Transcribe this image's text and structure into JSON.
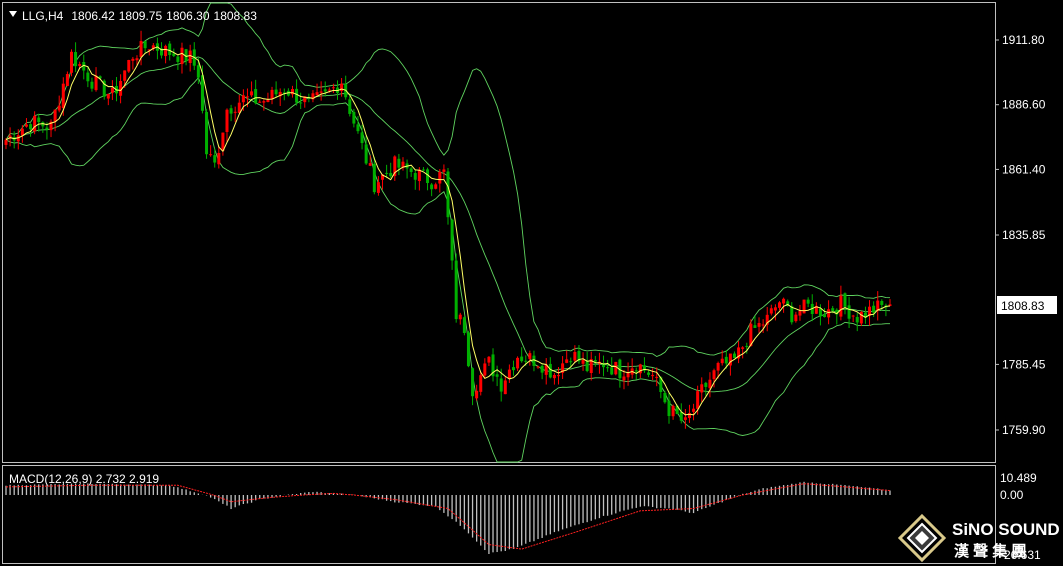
{
  "header": {
    "symbol": "LLG,H4",
    "open": "1806.42",
    "high": "1809.75",
    "low": "1806.30",
    "close": "1808.83"
  },
  "price_axis": {
    "ticks": [
      "1911.80",
      "1886.60",
      "1861.40",
      "1835.85",
      "1785.45",
      "1759.90"
    ],
    "current": "1808.83",
    "current_value": 1808.83,
    "tick_values": [
      1911.8,
      1886.6,
      1861.4,
      1835.85,
      1785.45,
      1759.9
    ],
    "range": [
      1744,
      1922
    ]
  },
  "macd": {
    "label": "MACD(12,26,9) 2.732 2.919",
    "ticks": [
      "10.489",
      "0.00",
      "-26.631"
    ],
    "tick_values": [
      10.489,
      0.0,
      -26.631
    ],
    "range": [
      -27.5,
      12.5
    ]
  },
  "logo": {
    "name": "SiNO SOUND",
    "subtitle": "漢 聲 集 團"
  },
  "colors": {
    "background": "#000000",
    "bull_candle": "#ff0000",
    "bear_candle": "#00b000",
    "bollinger": "#5fd35f",
    "moving_average": "#ffff66",
    "macd_histogram": "#c0c0c0",
    "macd_signal": "#ff2020",
    "frame": "#c0c0c0"
  },
  "chart_data": [
    {
      "type": "candlestick",
      "title": "LLG,H4",
      "ylim": [
        1744,
        1922
      ],
      "keypoints_close": [
        {
          "bar": 0,
          "close": 1873
        },
        {
          "bar": 6,
          "close": 1880
        },
        {
          "bar": 11,
          "close": 1878
        },
        {
          "bar": 16,
          "close": 1906
        },
        {
          "bar": 21,
          "close": 1896
        },
        {
          "bar": 26,
          "close": 1890
        },
        {
          "bar": 31,
          "close": 1906
        },
        {
          "bar": 35,
          "close": 1910
        },
        {
          "bar": 40,
          "close": 1907
        },
        {
          "bar": 45,
          "close": 1905
        },
        {
          "bar": 47,
          "close": 1899
        },
        {
          "bar": 49,
          "close": 1868
        },
        {
          "bar": 51,
          "close": 1863
        },
        {
          "bar": 54,
          "close": 1885
        },
        {
          "bar": 58,
          "close": 1889
        },
        {
          "bar": 63,
          "close": 1888
        },
        {
          "bar": 68,
          "close": 1893
        },
        {
          "bar": 74,
          "close": 1887
        },
        {
          "bar": 78,
          "close": 1890
        },
        {
          "bar": 82,
          "close": 1896
        },
        {
          "bar": 84,
          "close": 1885
        },
        {
          "bar": 87,
          "close": 1870
        },
        {
          "bar": 90,
          "close": 1856
        },
        {
          "bar": 95,
          "close": 1863
        },
        {
          "bar": 100,
          "close": 1860
        },
        {
          "bar": 104,
          "close": 1857
        },
        {
          "bar": 107,
          "close": 1860
        },
        {
          "bar": 110,
          "close": 1805
        },
        {
          "bar": 112,
          "close": 1800
        },
        {
          "bar": 114,
          "close": 1776
        },
        {
          "bar": 118,
          "close": 1786
        },
        {
          "bar": 121,
          "close": 1778
        },
        {
          "bar": 125,
          "close": 1789
        },
        {
          "bar": 130,
          "close": 1787
        },
        {
          "bar": 134,
          "close": 1782
        },
        {
          "bar": 138,
          "close": 1790
        },
        {
          "bar": 142,
          "close": 1784
        },
        {
          "bar": 146,
          "close": 1786
        },
        {
          "bar": 150,
          "close": 1783
        },
        {
          "bar": 154,
          "close": 1786
        },
        {
          "bar": 158,
          "close": 1781
        },
        {
          "bar": 162,
          "close": 1768
        },
        {
          "bar": 166,
          "close": 1762
        },
        {
          "bar": 170,
          "close": 1775
        },
        {
          "bar": 174,
          "close": 1784
        },
        {
          "bar": 178,
          "close": 1787
        },
        {
          "bar": 182,
          "close": 1798
        },
        {
          "bar": 186,
          "close": 1803
        },
        {
          "bar": 189,
          "close": 1810
        },
        {
          "bar": 192,
          "close": 1805
        },
        {
          "bar": 196,
          "close": 1808
        },
        {
          "bar": 200,
          "close": 1806
        },
        {
          "bar": 204,
          "close": 1809
        },
        {
          "bar": 208,
          "close": 1804
        },
        {
          "bar": 212,
          "close": 1807
        },
        {
          "bar": 216,
          "close": 1808.83
        }
      ]
    },
    {
      "type": "bar",
      "title": "MACD(12,26,9) 2.732 2.919",
      "ylim": [
        -27.5,
        12.5
      ],
      "keypoints_macd": [
        {
          "bar": 0,
          "value": 6
        },
        {
          "bar": 20,
          "value": 7
        },
        {
          "bar": 40,
          "value": 6
        },
        {
          "bar": 50,
          "value": -1
        },
        {
          "bar": 55,
          "value": -6
        },
        {
          "bar": 62,
          "value": -2
        },
        {
          "bar": 75,
          "value": 2
        },
        {
          "bar": 85,
          "value": 0
        },
        {
          "bar": 95,
          "value": -3
        },
        {
          "bar": 105,
          "value": -5
        },
        {
          "bar": 112,
          "value": -15
        },
        {
          "bar": 118,
          "value": -26
        },
        {
          "bar": 124,
          "value": -24
        },
        {
          "bar": 135,
          "value": -16
        },
        {
          "bar": 145,
          "value": -10
        },
        {
          "bar": 155,
          "value": -5
        },
        {
          "bar": 162,
          "value": -6
        },
        {
          "bar": 168,
          "value": -8
        },
        {
          "bar": 175,
          "value": -3
        },
        {
          "bar": 185,
          "value": 4
        },
        {
          "bar": 195,
          "value": 8
        },
        {
          "bar": 205,
          "value": 6
        },
        {
          "bar": 216,
          "value": 2.9
        }
      ],
      "keypoints_signal": [
        {
          "bar": 0,
          "value": 5
        },
        {
          "bar": 20,
          "value": 6
        },
        {
          "bar": 42,
          "value": 6
        },
        {
          "bar": 55,
          "value": -3
        },
        {
          "bar": 65,
          "value": -1
        },
        {
          "bar": 80,
          "value": 1
        },
        {
          "bar": 95,
          "value": -2
        },
        {
          "bar": 108,
          "value": -6
        },
        {
          "bar": 118,
          "value": -22
        },
        {
          "bar": 126,
          "value": -24
        },
        {
          "bar": 140,
          "value": -16
        },
        {
          "bar": 155,
          "value": -7
        },
        {
          "bar": 168,
          "value": -6
        },
        {
          "bar": 180,
          "value": 0
        },
        {
          "bar": 195,
          "value": 7
        },
        {
          "bar": 205,
          "value": 5
        },
        {
          "bar": 216,
          "value": 2.732
        }
      ]
    }
  ]
}
